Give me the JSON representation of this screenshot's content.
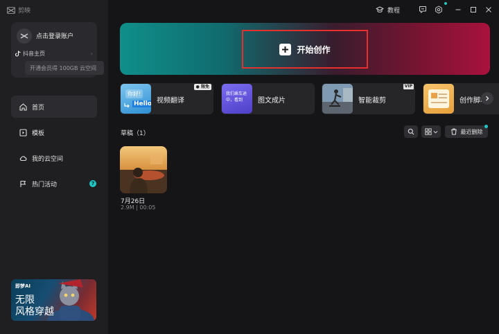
{
  "app": {
    "name": "剪映"
  },
  "sidebar": {
    "account": {
      "login_label": "点击登录账户",
      "douyin_label": "抖音主页",
      "vip_promo": "开通会员得 100GB 云空间"
    },
    "nav": [
      {
        "label": "首页",
        "icon": "home-icon",
        "active": true
      },
      {
        "label": "模板",
        "icon": "template-icon",
        "active": false
      },
      {
        "label": "我的云空间",
        "icon": "cloud-icon",
        "active": false
      },
      {
        "label": "热门活动",
        "icon": "flag-icon",
        "active": false,
        "badge": "7"
      }
    ],
    "promo": {
      "brand": "即梦AI",
      "line1": "无限",
      "line2": "风格穿越"
    }
  },
  "titlebar": {
    "tutorial_label": "教程"
  },
  "hero": {
    "start_label": "开始创作"
  },
  "tools": [
    {
      "label": "视频翻译",
      "badge": "限免",
      "thumb_text_1": "你好!",
      "thumb_text_2": "Hello"
    },
    {
      "label": "图文成片",
      "thumb_text": "我们乘车途中，看到"
    },
    {
      "label": "智能裁剪",
      "badge": "VIP"
    },
    {
      "label": "创作脚本"
    }
  ],
  "drafts": {
    "title": "草稿（1）",
    "recent_delete_label": "最近删除",
    "items": [
      {
        "name": "7月26日",
        "meta": "2.9M | 00:05"
      }
    ]
  },
  "colors": {
    "accent": "#1ec7c4",
    "highlight_border": "#e5302b"
  }
}
